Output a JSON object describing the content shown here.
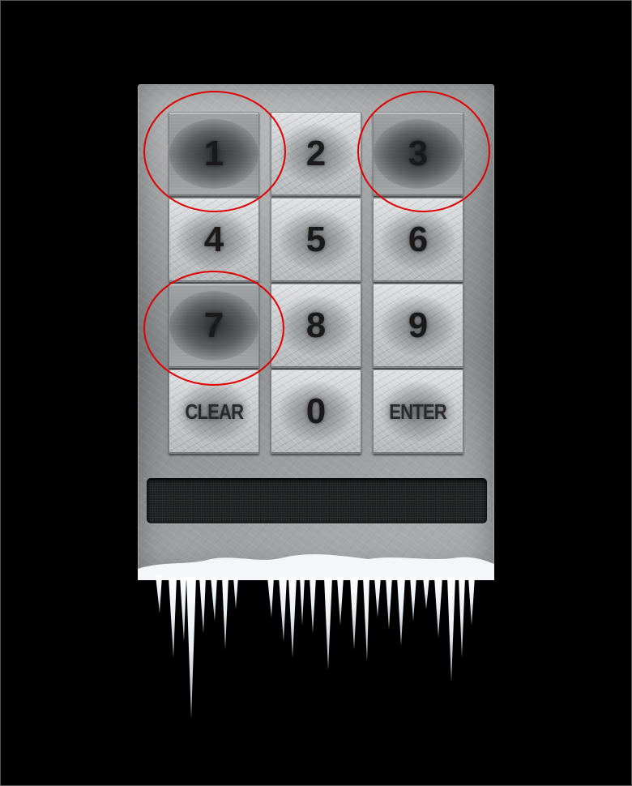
{
  "keypad": {
    "keys": [
      {
        "label": "1"
      },
      {
        "label": "2"
      },
      {
        "label": "3"
      },
      {
        "label": "4"
      },
      {
        "label": "5"
      },
      {
        "label": "6"
      },
      {
        "label": "7"
      },
      {
        "label": "8"
      },
      {
        "label": "9"
      },
      {
        "label": "CLEAR"
      },
      {
        "label": "0"
      },
      {
        "label": "ENTER"
      }
    ],
    "highlighted_keys": [
      "1",
      "3",
      "7"
    ],
    "highlight_color": "#e00000"
  },
  "display": {
    "value": ""
  },
  "decoration": {
    "icon": "icicles-icon",
    "panel_material": "frosted-metal"
  }
}
